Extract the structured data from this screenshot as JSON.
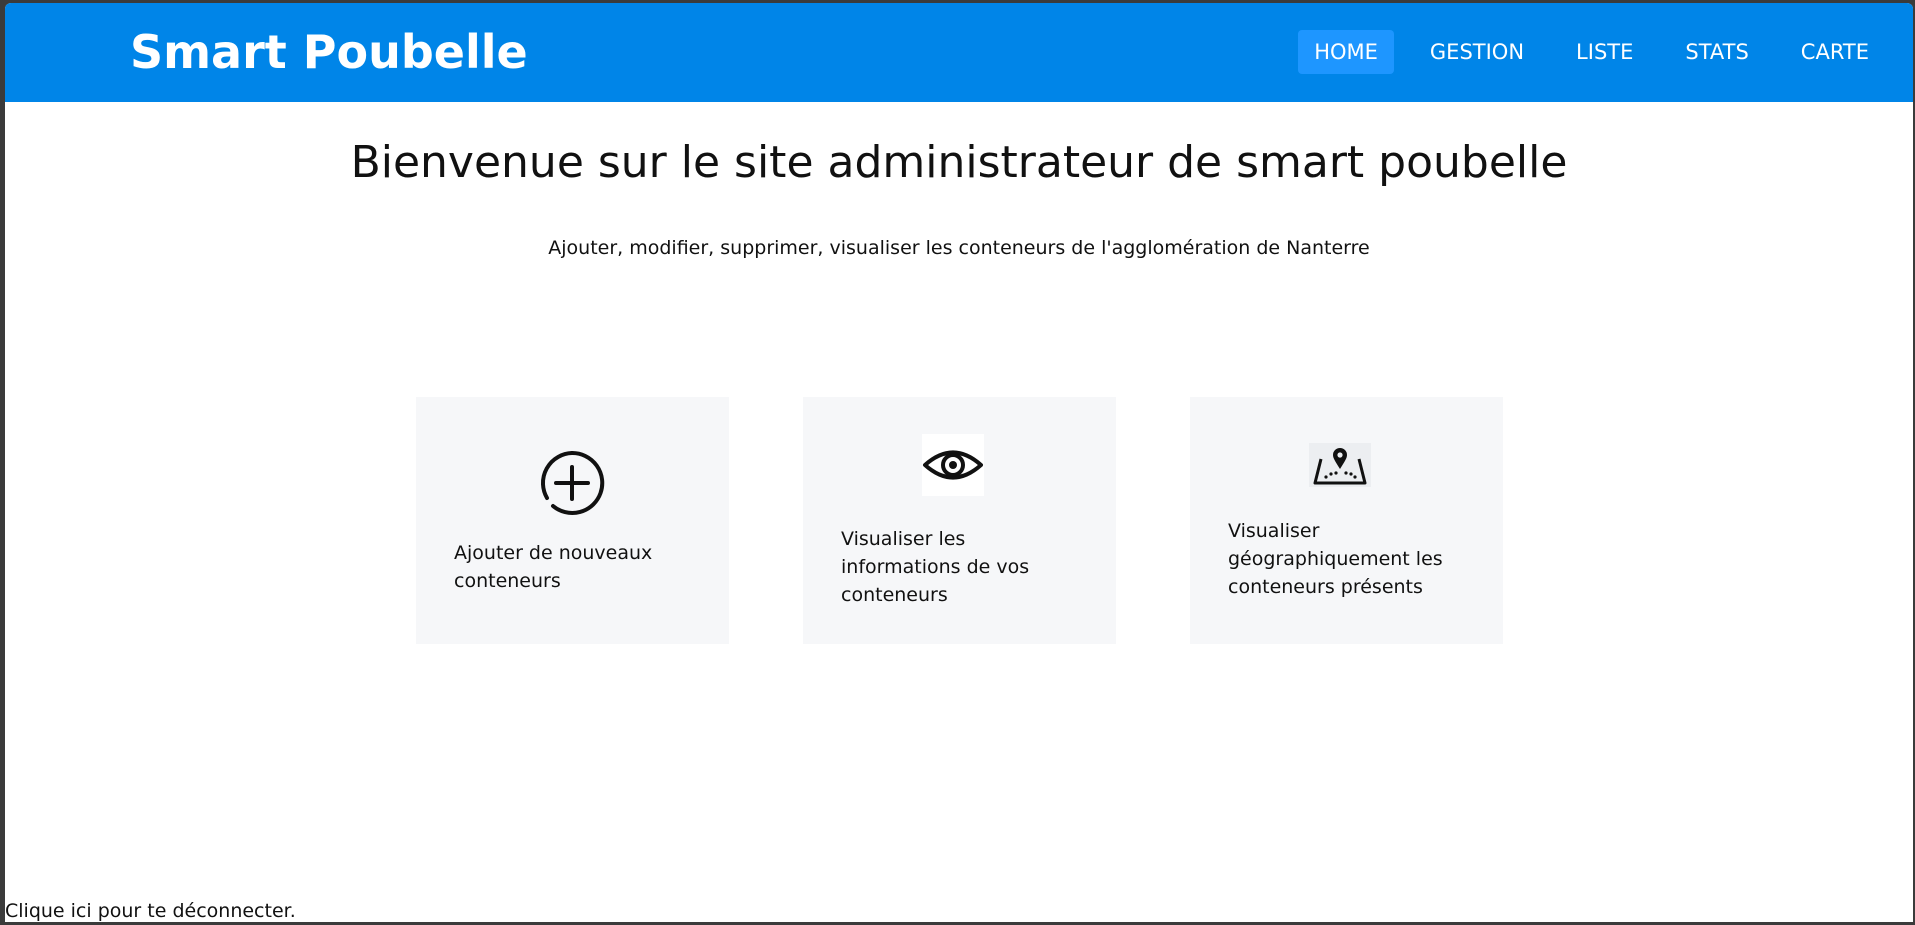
{
  "header": {
    "brand": "Smart Poubelle",
    "brand_color": "#0085e8",
    "nav": [
      {
        "label": "HOME",
        "active": true
      },
      {
        "label": "GESTION",
        "active": false
      },
      {
        "label": "LISTE",
        "active": false
      },
      {
        "label": "STATS",
        "active": false
      },
      {
        "label": "CARTE",
        "active": false
      }
    ]
  },
  "main": {
    "title": "Bienvenue sur le site administrateur de smart poubelle",
    "subtitle": "Ajouter, modifier, supprimer, visualiser les conteneurs de l'agglomération de Nanterre",
    "cards": [
      {
        "icon": "plus-circle-icon",
        "text": "Ajouter de nouveaux conteneurs"
      },
      {
        "icon": "eye-icon",
        "text": "Visualiser les informations de vos conteneurs"
      },
      {
        "icon": "map-pin-icon",
        "text": "Visualiser géographiquement les conteneurs présents"
      }
    ]
  },
  "footer": {
    "logout": "Clique ici pour te déconnecter."
  }
}
